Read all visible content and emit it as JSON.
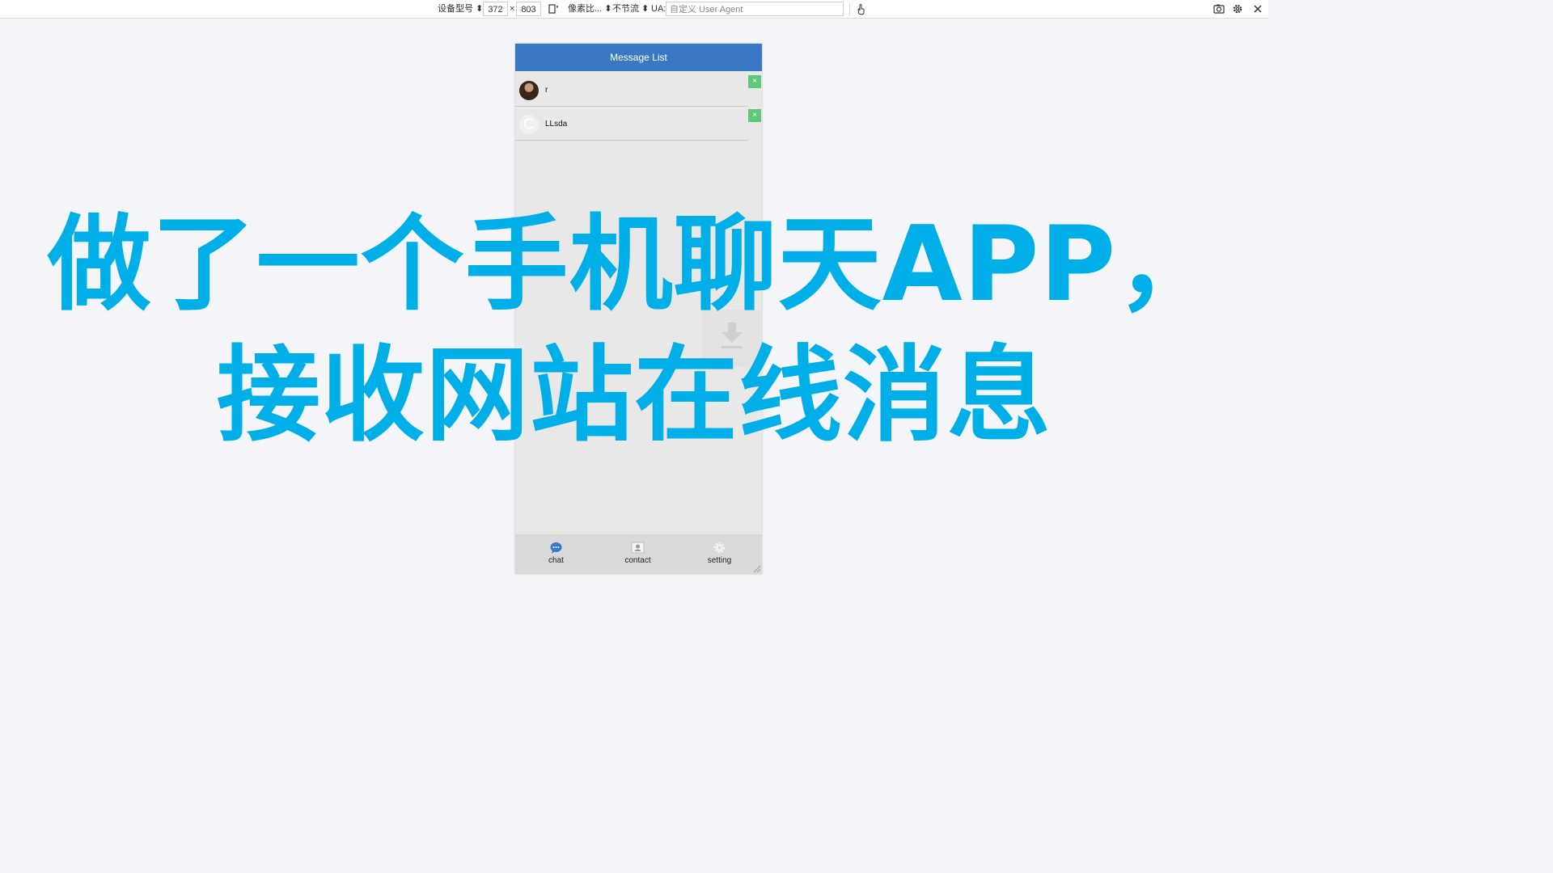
{
  "toolbar": {
    "device_model": "设备型号 ⬍",
    "width": "372",
    "times": "×",
    "height": "803",
    "pixel_ratio": "像素比... ⬍",
    "throttle": "不节流 ⬍",
    "ua_label": "UA:",
    "ua_placeholder": "自定义 User Agent"
  },
  "app": {
    "title": "Message List",
    "messages": [
      {
        "name": "r",
        "avatar": "photo"
      },
      {
        "name": "LLsda",
        "avatar": "letter",
        "letter": "C"
      }
    ],
    "delete_label": "×",
    "tabs": [
      {
        "label": "chat",
        "icon": "chat-icon"
      },
      {
        "label": "contact",
        "icon": "contact-icon"
      },
      {
        "label": "setting",
        "icon": "gear-icon"
      }
    ]
  },
  "caption": {
    "line1": "做了一个手机聊天APP，",
    "line2": "接收网站在线消息"
  },
  "colors": {
    "header": "#3b78c3",
    "caption": "#00aee8",
    "delete": "#5cc97a"
  }
}
